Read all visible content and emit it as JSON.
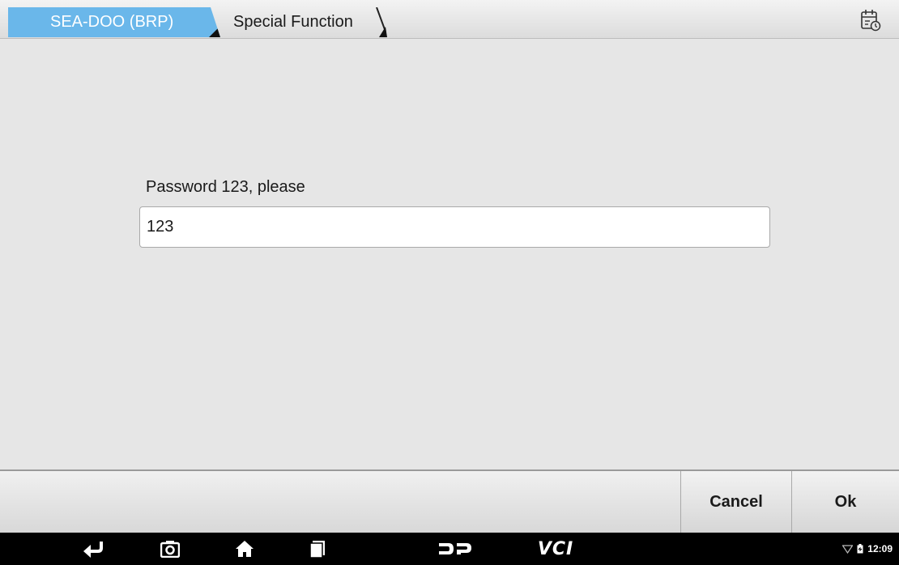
{
  "breadcrumb": {
    "items": [
      {
        "label": "SEA-DOO (BRP)"
      },
      {
        "label": "Special Function"
      }
    ]
  },
  "header": {
    "right_icon": "report-calendar-icon"
  },
  "dialog": {
    "prompt": "Password 123, please",
    "input_value": "123"
  },
  "actions": {
    "cancel_label": "Cancel",
    "ok_label": "Ok"
  },
  "navbar": {
    "icons": [
      "back-icon",
      "screenshot-icon",
      "home-icon",
      "recents-icon",
      "dp-icon",
      "vci-icon"
    ],
    "vci_label": "VCI"
  },
  "status": {
    "time": "12:09",
    "icons": [
      "wifi-icon",
      "battery-icon"
    ]
  },
  "colors": {
    "crumb_active": "#6ab7ea",
    "background": "#e6e6e6",
    "navbar": "#000000"
  }
}
